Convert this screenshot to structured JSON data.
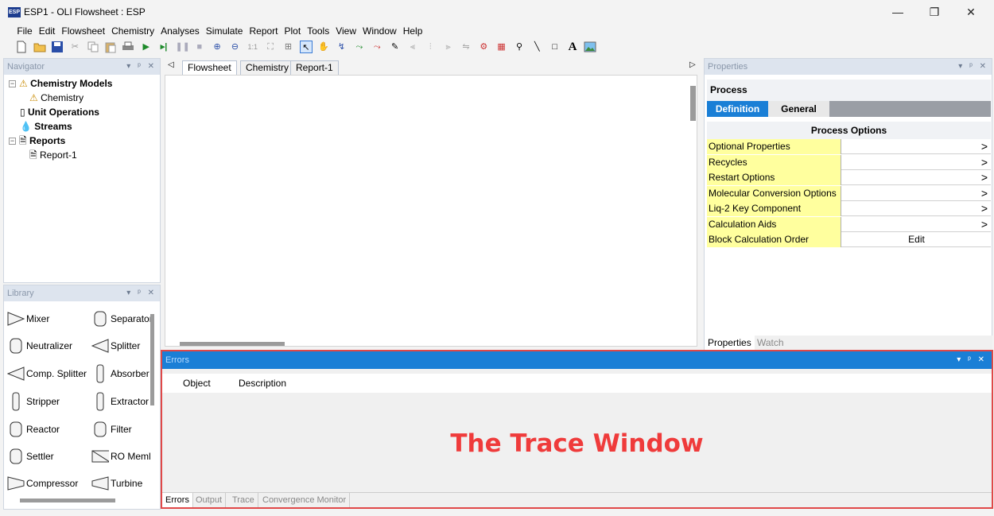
{
  "window": {
    "title": "ESP1 - OLI Flowsheet : ESP",
    "icon_text": "ESP",
    "minimize": "—",
    "restore": "❐",
    "close": "✕"
  },
  "menu": [
    "File",
    "Edit",
    "Flowsheet",
    "Chemistry",
    "Analyses",
    "Simulate",
    "Report",
    "Plot",
    "Tools",
    "View",
    "Window",
    "Help"
  ],
  "navigator": {
    "title": "Navigator",
    "pin": "▾ ᵖ ✕",
    "items": {
      "chemistry_models": "Chemistry Models",
      "chemistry": "Chemistry",
      "unit_operations": "Unit Operations",
      "streams": "Streams",
      "reports": "Reports",
      "report1": "Report-1"
    }
  },
  "library": {
    "title": "Library",
    "pin": "▾ ᵖ ✕",
    "items": [
      "Mixer",
      "Separator",
      "Neutralizer",
      "Splitter",
      "Comp. Splitter",
      "Absorber",
      "Stripper",
      "Extractor",
      "Reactor",
      "Filter",
      "Settler",
      "RO Meml",
      "Compressor",
      "Turbine"
    ]
  },
  "doc_tabs": [
    "Flowsheet",
    "Chemistry",
    "Report-1"
  ],
  "properties": {
    "title": "Properties",
    "pin": "▾ ᵖ ✕",
    "section": "Process",
    "tabs": [
      "Definition",
      "General"
    ],
    "options_header": "Process Options",
    "rows": [
      {
        "label": "Optional Properties",
        "value": "",
        "chev": ">"
      },
      {
        "label": "Recycles",
        "value": "",
        "chev": ">"
      },
      {
        "label": "Restart Options",
        "value": "",
        "chev": ">"
      },
      {
        "label": "Molecular Conversion Options",
        "value": "",
        "chev": ">"
      },
      {
        "label": "Liq-2 Key Component",
        "value": "",
        "chev": ">"
      },
      {
        "label": "Calculation Aids",
        "value": "",
        "chev": ">"
      },
      {
        "label": "Block Calculation Order",
        "value": "Edit",
        "chev": ""
      }
    ],
    "bottom_tabs": [
      "Properties",
      "Watch"
    ]
  },
  "errors": {
    "title": "Errors",
    "pin": "▾ ᵖ ✕",
    "columns": [
      "Object",
      "Description"
    ],
    "annotation": "The Trace Window",
    "tabs": [
      "Errors",
      "Output",
      "Trace",
      "Convergence Monitor"
    ]
  },
  "colors": {
    "accent": "#1a7fd6",
    "annotation": "#ef3b3b",
    "highlight": "#ffff9e"
  }
}
